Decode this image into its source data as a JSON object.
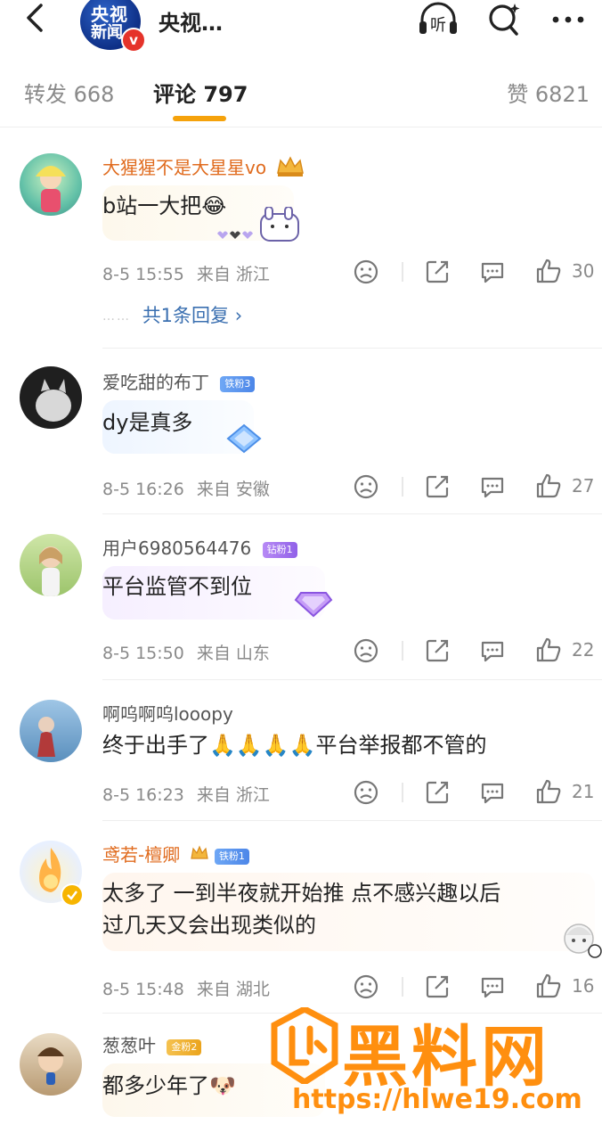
{
  "header": {
    "account_name": "央视…",
    "avatar_line1": "央视",
    "avatar_line2": "新闻",
    "verified_mark": "v",
    "listen_label": "听"
  },
  "tabs": {
    "repost": "转发 668",
    "comments": "评论 797",
    "likes": "赞 6821"
  },
  "comments": [
    {
      "user": "大猩猩不是大星星vo",
      "text": "b站一大把😂",
      "time": "8-5 15:55",
      "location": "来自 浙江",
      "likes": "30",
      "replies": "共1条回复 ›",
      "replies_dots": "……"
    },
    {
      "user": "爱吃甜的布丁",
      "badge": "铁粉3",
      "text": "dy是真多",
      "time": "8-5 16:26",
      "location": "来自 安徽",
      "likes": "27"
    },
    {
      "user": "用户6980564476",
      "badge": "钻粉1",
      "text": "平台监管不到位",
      "time": "8-5 15:50",
      "location": "来自 山东",
      "likes": "22"
    },
    {
      "user": "啊呜啊呜looopy",
      "text": "终于出手了🙏🙏🙏🙏平台举报都不管的",
      "time": "8-5 16:23",
      "location": "来自 浙江",
      "likes": "21"
    },
    {
      "user": "鸢若-檀卿",
      "badge": "铁粉1",
      "text_line1": "太多了 一到半夜就开始推 点不感兴趣以后",
      "text_line2": "过几天又会出现类似的",
      "time": "8-5 15:48",
      "location": "来自 湖北",
      "likes": "16"
    },
    {
      "user": "葱葱叶",
      "badge": "金粉2",
      "text": "都多少年了🐶"
    }
  ],
  "watermark": {
    "title": "黑料网",
    "url": "https://hlwe19.com"
  },
  "colors": {
    "accent": "#f5a20b",
    "orange_name": "#e06b1e",
    "link_blue": "#3a6fb0",
    "watermark": "#ff8f0f"
  }
}
